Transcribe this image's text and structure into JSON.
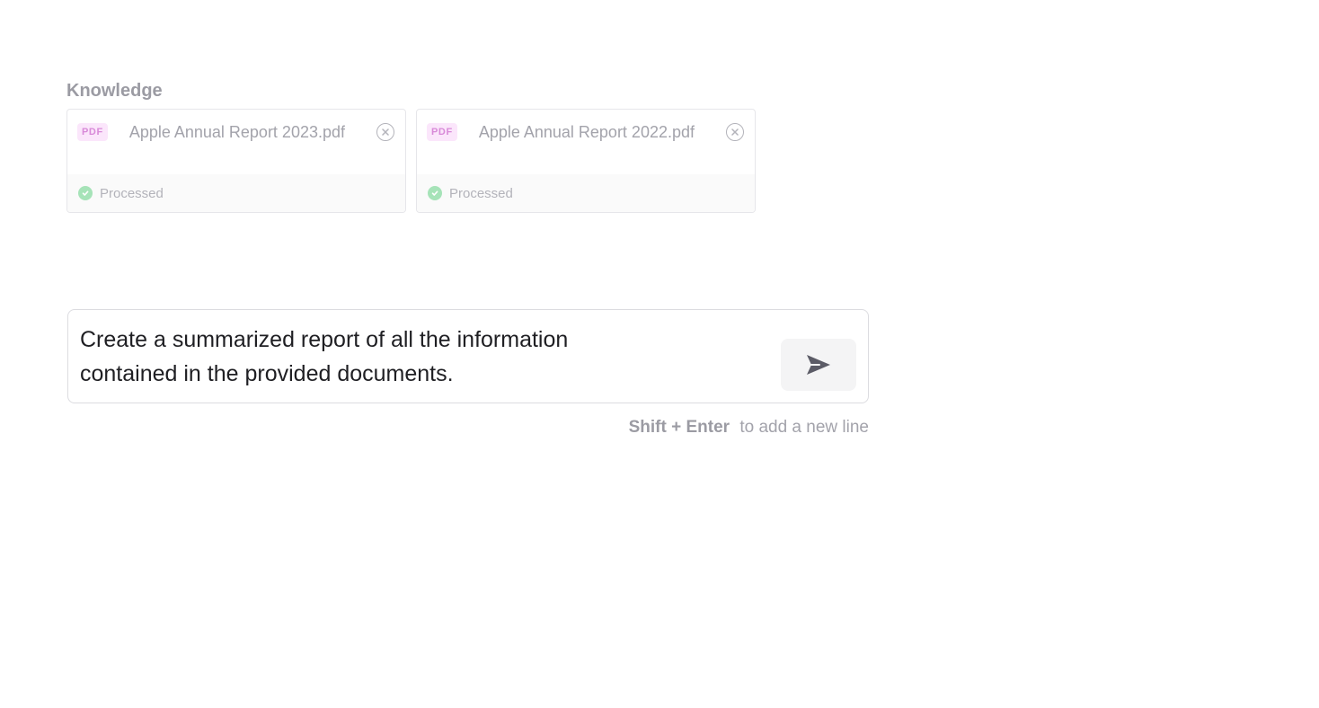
{
  "knowledge": {
    "heading": "Knowledge",
    "files": [
      {
        "type_label": "PDF",
        "name": "Apple Annual Report 2023.pdf",
        "status": "Processed"
      },
      {
        "type_label": "PDF",
        "name": "Apple Annual Report 2022.pdf",
        "status": "Processed"
      }
    ]
  },
  "composer": {
    "prompt": "Create a summarized report of all the information\ncontained in the provided documents."
  },
  "hint": {
    "keys": "Shift + Enter",
    "text": "to add a new line"
  },
  "icons": {
    "remove": "close-circle-icon",
    "status": "check-circle-icon",
    "send": "send-icon"
  },
  "colors": {
    "pdf_badge_bg": "#fbe6fb",
    "pdf_badge_text": "#d88ad8",
    "processed_green": "#a6e3b8"
  }
}
